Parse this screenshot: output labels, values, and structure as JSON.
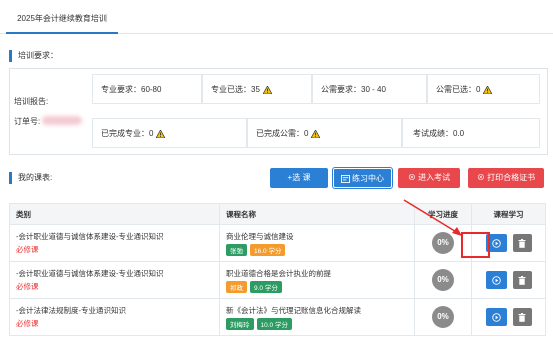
{
  "tab": {
    "title": "2025年会计继续教育培训"
  },
  "training_req": {
    "title": "培训要求："
  },
  "report": {
    "label": "培训报告:",
    "order_label": "订单号:",
    "cells": {
      "prof_req": "专业要求：60-80",
      "prof_done": "专业已选：35",
      "pub_req": "公需要求：30 - 40",
      "pub_done": "公需已选：0",
      "prof_completed": "已完成专业：0",
      "pub_completed": "已完成公需：0",
      "exam_score": "考试成绩：0.0"
    }
  },
  "my_courses": {
    "title": "我的课表:"
  },
  "buttons": {
    "add": "+选 课",
    "practice": "练习中心",
    "exam": "进入考试",
    "cert": "打印合格证书"
  },
  "table": {
    "headers": [
      "类别",
      "课程名称",
      "学习进度",
      "课程学习"
    ],
    "rows": [
      {
        "category": "-会计职业道德与诚信体系建设-专业通识知识",
        "req": "必修课",
        "course": "商业伦理与诚信建设",
        "teacher": "张弛",
        "credit": "16.0 学分",
        "progress": "0%"
      },
      {
        "category": "-会计职业道德与诚信体系建设-专业通识知识",
        "req": "必修课",
        "course": "职业道德合格是会计执业的前提",
        "teacher": "祁政",
        "credit": "9.0 学分",
        "progress": "0%"
      },
      {
        "category": "-会计法律法规制度-专业通识知识",
        "req": "必修课",
        "course": "新《会计法》与代理记账信息化合规解读",
        "teacher": "刘梅玲",
        "credit": "10.0 学分",
        "progress": "0%"
      }
    ]
  },
  "colors": {
    "accent": "#2b7fd4",
    "danger": "#e8474c",
    "required": "#ee3333"
  }
}
